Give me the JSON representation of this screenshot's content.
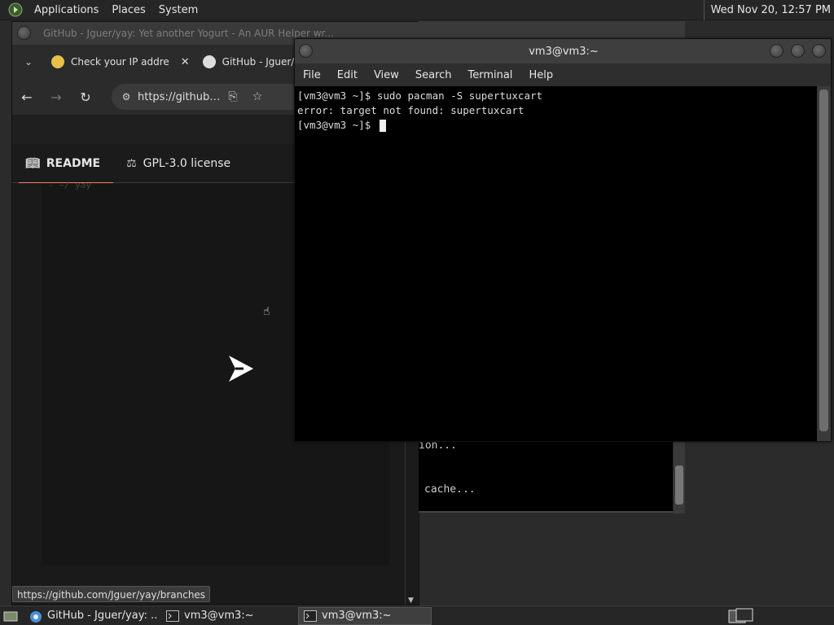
{
  "top_panel": {
    "menus": [
      "Applications",
      "Places",
      "System"
    ],
    "clock": "Wed Nov 20, 12:57 PM"
  },
  "browser": {
    "window_title": "GitHub - Jguer/yay: Yet another Yogurt - An AUR Helper wr...",
    "tabs": [
      {
        "label": "Check your IP addre",
        "icon": "favicon-ip-icon"
      },
      {
        "label": "GitHub - Jguer/",
        "icon": "github-icon"
      }
    ],
    "url": "https://github.com",
    "repo_tabs": [
      {
        "label": "README",
        "icon": "book-icon"
      },
      {
        "label": "GPL-3.0 license",
        "icon": "scale-icon"
      }
    ],
    "code_snippet": "- ~/ yay",
    "status_url": "https://github.com/Jguer/yay/branches"
  },
  "terminal_back": {
    "line1": "ion...",
    "line2": "cache..."
  },
  "terminal": {
    "title": "vm3@vm3:~",
    "menu": [
      "File",
      "Edit",
      "View",
      "Search",
      "Terminal",
      "Help"
    ],
    "lines": [
      "[vm3@vm3 ~]$ sudo pacman -S supertuxcart",
      "error: target not found: supertuxcart",
      "[vm3@vm3 ~]$ "
    ]
  },
  "taskbar": {
    "tasks": [
      {
        "label": "GitHub - Jguer/yay: ...",
        "icon": "chromium-icon"
      },
      {
        "label": "vm3@vm3:~",
        "icon": "terminal-icon"
      },
      {
        "label": "vm3@vm3:~",
        "icon": "terminal-icon"
      }
    ]
  },
  "colors": {
    "accent_underline": "#f78166",
    "terminal_bg": "#000000",
    "panel_bg": "#262626"
  }
}
